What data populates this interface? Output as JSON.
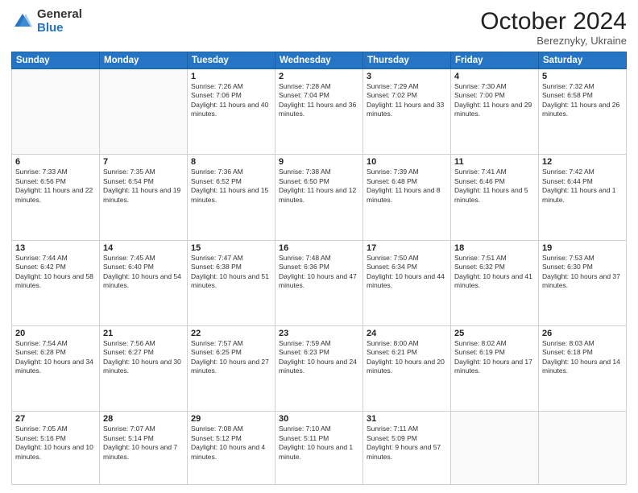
{
  "logo": {
    "general": "General",
    "blue": "Blue"
  },
  "header": {
    "month": "October 2024",
    "location": "Bereznyky, Ukraine"
  },
  "weekdays": [
    "Sunday",
    "Monday",
    "Tuesday",
    "Wednesday",
    "Thursday",
    "Friday",
    "Saturday"
  ],
  "weeks": [
    [
      {
        "day": "",
        "sunrise": "",
        "sunset": "",
        "daylight": ""
      },
      {
        "day": "",
        "sunrise": "",
        "sunset": "",
        "daylight": ""
      },
      {
        "day": "1",
        "sunrise": "Sunrise: 7:26 AM",
        "sunset": "Sunset: 7:06 PM",
        "daylight": "Daylight: 11 hours and 40 minutes."
      },
      {
        "day": "2",
        "sunrise": "Sunrise: 7:28 AM",
        "sunset": "Sunset: 7:04 PM",
        "daylight": "Daylight: 11 hours and 36 minutes."
      },
      {
        "day": "3",
        "sunrise": "Sunrise: 7:29 AM",
        "sunset": "Sunset: 7:02 PM",
        "daylight": "Daylight: 11 hours and 33 minutes."
      },
      {
        "day": "4",
        "sunrise": "Sunrise: 7:30 AM",
        "sunset": "Sunset: 7:00 PM",
        "daylight": "Daylight: 11 hours and 29 minutes."
      },
      {
        "day": "5",
        "sunrise": "Sunrise: 7:32 AM",
        "sunset": "Sunset: 6:58 PM",
        "daylight": "Daylight: 11 hours and 26 minutes."
      }
    ],
    [
      {
        "day": "6",
        "sunrise": "Sunrise: 7:33 AM",
        "sunset": "Sunset: 6:56 PM",
        "daylight": "Daylight: 11 hours and 22 minutes."
      },
      {
        "day": "7",
        "sunrise": "Sunrise: 7:35 AM",
        "sunset": "Sunset: 6:54 PM",
        "daylight": "Daylight: 11 hours and 19 minutes."
      },
      {
        "day": "8",
        "sunrise": "Sunrise: 7:36 AM",
        "sunset": "Sunset: 6:52 PM",
        "daylight": "Daylight: 11 hours and 15 minutes."
      },
      {
        "day": "9",
        "sunrise": "Sunrise: 7:38 AM",
        "sunset": "Sunset: 6:50 PM",
        "daylight": "Daylight: 11 hours and 12 minutes."
      },
      {
        "day": "10",
        "sunrise": "Sunrise: 7:39 AM",
        "sunset": "Sunset: 6:48 PM",
        "daylight": "Daylight: 11 hours and 8 minutes."
      },
      {
        "day": "11",
        "sunrise": "Sunrise: 7:41 AM",
        "sunset": "Sunset: 6:46 PM",
        "daylight": "Daylight: 11 hours and 5 minutes."
      },
      {
        "day": "12",
        "sunrise": "Sunrise: 7:42 AM",
        "sunset": "Sunset: 6:44 PM",
        "daylight": "Daylight: 11 hours and 1 minute."
      }
    ],
    [
      {
        "day": "13",
        "sunrise": "Sunrise: 7:44 AM",
        "sunset": "Sunset: 6:42 PM",
        "daylight": "Daylight: 10 hours and 58 minutes."
      },
      {
        "day": "14",
        "sunrise": "Sunrise: 7:45 AM",
        "sunset": "Sunset: 6:40 PM",
        "daylight": "Daylight: 10 hours and 54 minutes."
      },
      {
        "day": "15",
        "sunrise": "Sunrise: 7:47 AM",
        "sunset": "Sunset: 6:38 PM",
        "daylight": "Daylight: 10 hours and 51 minutes."
      },
      {
        "day": "16",
        "sunrise": "Sunrise: 7:48 AM",
        "sunset": "Sunset: 6:36 PM",
        "daylight": "Daylight: 10 hours and 47 minutes."
      },
      {
        "day": "17",
        "sunrise": "Sunrise: 7:50 AM",
        "sunset": "Sunset: 6:34 PM",
        "daylight": "Daylight: 10 hours and 44 minutes."
      },
      {
        "day": "18",
        "sunrise": "Sunrise: 7:51 AM",
        "sunset": "Sunset: 6:32 PM",
        "daylight": "Daylight: 10 hours and 41 minutes."
      },
      {
        "day": "19",
        "sunrise": "Sunrise: 7:53 AM",
        "sunset": "Sunset: 6:30 PM",
        "daylight": "Daylight: 10 hours and 37 minutes."
      }
    ],
    [
      {
        "day": "20",
        "sunrise": "Sunrise: 7:54 AM",
        "sunset": "Sunset: 6:28 PM",
        "daylight": "Daylight: 10 hours and 34 minutes."
      },
      {
        "day": "21",
        "sunrise": "Sunrise: 7:56 AM",
        "sunset": "Sunset: 6:27 PM",
        "daylight": "Daylight: 10 hours and 30 minutes."
      },
      {
        "day": "22",
        "sunrise": "Sunrise: 7:57 AM",
        "sunset": "Sunset: 6:25 PM",
        "daylight": "Daylight: 10 hours and 27 minutes."
      },
      {
        "day": "23",
        "sunrise": "Sunrise: 7:59 AM",
        "sunset": "Sunset: 6:23 PM",
        "daylight": "Daylight: 10 hours and 24 minutes."
      },
      {
        "day": "24",
        "sunrise": "Sunrise: 8:00 AM",
        "sunset": "Sunset: 6:21 PM",
        "daylight": "Daylight: 10 hours and 20 minutes."
      },
      {
        "day": "25",
        "sunrise": "Sunrise: 8:02 AM",
        "sunset": "Sunset: 6:19 PM",
        "daylight": "Daylight: 10 hours and 17 minutes."
      },
      {
        "day": "26",
        "sunrise": "Sunrise: 8:03 AM",
        "sunset": "Sunset: 6:18 PM",
        "daylight": "Daylight: 10 hours and 14 minutes."
      }
    ],
    [
      {
        "day": "27",
        "sunrise": "Sunrise: 7:05 AM",
        "sunset": "Sunset: 5:16 PM",
        "daylight": "Daylight: 10 hours and 10 minutes."
      },
      {
        "day": "28",
        "sunrise": "Sunrise: 7:07 AM",
        "sunset": "Sunset: 5:14 PM",
        "daylight": "Daylight: 10 hours and 7 minutes."
      },
      {
        "day": "29",
        "sunrise": "Sunrise: 7:08 AM",
        "sunset": "Sunset: 5:12 PM",
        "daylight": "Daylight: 10 hours and 4 minutes."
      },
      {
        "day": "30",
        "sunrise": "Sunrise: 7:10 AM",
        "sunset": "Sunset: 5:11 PM",
        "daylight": "Daylight: 10 hours and 1 minute."
      },
      {
        "day": "31",
        "sunrise": "Sunrise: 7:11 AM",
        "sunset": "Sunset: 5:09 PM",
        "daylight": "Daylight: 9 hours and 57 minutes."
      },
      {
        "day": "",
        "sunrise": "",
        "sunset": "",
        "daylight": ""
      },
      {
        "day": "",
        "sunrise": "",
        "sunset": "",
        "daylight": ""
      }
    ]
  ]
}
